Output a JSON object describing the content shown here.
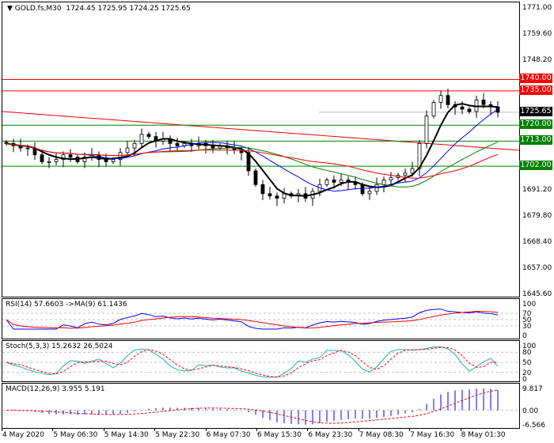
{
  "header": {
    "symbol": "GOLD.fs,M30",
    "ohlc": "1724.45 1725.95 1724.25 1725.65"
  },
  "price_axis": {
    "labels": [
      "1771.00",
      "1759.60",
      "1748.20",
      "1691.20",
      "1679.80",
      "1668.40",
      "1657.00",
      "1645.60"
    ]
  },
  "levels": [
    {
      "label": "1740.00",
      "price": 1740.0,
      "color": "#ff0000"
    },
    {
      "label": "1735.00",
      "price": 1735.0,
      "color": "#ff0000"
    },
    {
      "label": "1720.00",
      "price": 1720.0,
      "color": "#008000"
    },
    {
      "label": "1713.00",
      "price": 1713.0,
      "color": "#008000"
    },
    {
      "label": "1702.00",
      "price": 1702.0,
      "color": "#008000"
    }
  ],
  "current_price": {
    "label": "1725.65",
    "price": 1725.65,
    "color": "#000000"
  },
  "indicators": {
    "rsi": {
      "label": "RSI(14) 57.6603  ->MA(9) 61.1436",
      "levels": [
        "100",
        "70",
        "50",
        "30",
        "0"
      ]
    },
    "stoch": {
      "label": "Stoch(5,3,3) 15.2632 26.5024",
      "levels": [
        "100",
        "80",
        "50",
        "20",
        "0"
      ]
    },
    "macd": {
      "label": "MACD(12,26,9) 3.955 5.191",
      "levels": [
        "9.817",
        "0.00",
        "-6.566"
      ]
    }
  },
  "time_axis": [
    "4 May 2020",
    "5 May 06:30",
    "5 May 14:30",
    "5 May 22:30",
    "6 May 07:30",
    "6 May 15:30",
    "6 May 23:30",
    "7 May 08:30",
    "7 May 16:30",
    "8 May 01:30"
  ],
  "chart_data": {
    "type": "candlestick",
    "closes": [
      1712,
      1711,
      1710,
      1710,
      1707,
      1704,
      1704,
      1705,
      1707,
      1706,
      1704,
      1706,
      1707,
      1705,
      1704,
      1705,
      1708,
      1710,
      1712,
      1716,
      1715,
      1713,
      1714,
      1712,
      1711,
      1712,
      1711,
      1712,
      1711,
      1710,
      1711,
      1710,
      1709,
      1708,
      1700,
      1694,
      1690,
      1689,
      1688,
      1690,
      1689,
      1690,
      1688,
      1691,
      1694,
      1696,
      1695,
      1696,
      1695,
      1694,
      1690,
      1691,
      1694,
      1696,
      1697,
      1698,
      1699,
      1701,
      1712,
      1724,
      1730,
      1733,
      1729,
      1728,
      1727,
      1726,
      1731,
      1729,
      1728,
      1725.65
    ],
    "ylim": [
      1645.6,
      1771.0
    ],
    "colors": {
      "up": "#008000",
      "down": "#ff0000",
      "ma_fast": "#000000",
      "ma_mid": "#0000ff",
      "ma_slow1": "#008000",
      "ma_slow2": "#ff0000"
    }
  }
}
